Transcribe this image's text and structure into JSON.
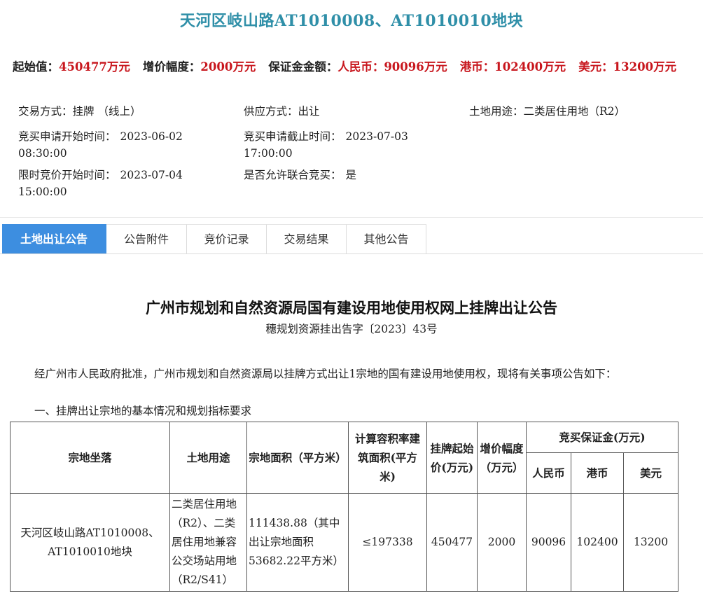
{
  "plot_title": "天河区岐山路AT1010008、AT1010010地块",
  "price_row": {
    "start_label": "起始值：",
    "start_value": "450477万元",
    "increment_label": "增价幅度：",
    "increment_value": "2000万元",
    "deposit_label": "保证金金额：",
    "rmb_label": "人民币：",
    "rmb_value": "90096万元",
    "hkd_label": "港币：",
    "hkd_value": "102400万元",
    "usd_label": "美元：",
    "usd_value": "13200万元"
  },
  "info": {
    "trade_mode_label": "交易方式：",
    "trade_mode_value": "挂牌 （线上）",
    "supply_mode_label": "供应方式：",
    "supply_mode_value": "出让",
    "land_use_label": "土地用途：",
    "land_use_value": "二类居住用地（R2）",
    "apply_start_label": "竞买申请开始时间：",
    "apply_start_date": "2023-06-02",
    "apply_start_time": "08:30:00",
    "apply_end_label": "竞买申请截止时间：",
    "apply_end_date": "2023-07-03",
    "apply_end_time": "17:00:00",
    "bid_start_label": "限时竞价开始时间：",
    "bid_start_date": "2023-07-04",
    "bid_start_time": "15:00:00",
    "joint_bid_label": "是否允许联合竞买：",
    "joint_bid_value": "是"
  },
  "tabs": [
    "土地出让公告",
    "公告附件",
    "竞价记录",
    "交易结果",
    "其他公告"
  ],
  "doc": {
    "title": "广州市规划和自然资源局国有建设用地使用权网上挂牌出让公告",
    "subtitle": "穗规划资源挂出告字〔2023〕43号",
    "para1": "经广州市人民政府批准，广州市规划和自然资源局以挂牌方式出让1宗地的国有建设用地使用权，现将有关事项公告如下：",
    "section1": "一、挂牌出让宗地的基本情况和规划指标要求"
  },
  "table": {
    "headers": {
      "location": "宗地坐落",
      "use": "土地用途",
      "area": "宗地面积（平方米）",
      "far": "计算容积率建筑面积(平方米)",
      "start_price": "挂牌起始价(万元)",
      "increment": "增价幅度（万元）",
      "deposit": "竞买保证金(万元)",
      "rmb": "人民币",
      "hkd": "港币",
      "usd": "美元"
    },
    "row": {
      "location": "天河区岐山路AT1010008、AT1010010地块",
      "use": "二类居住用地（R2）、二类居住用地兼容公交场站用地（R2/S41）",
      "area": "111438.88（其中出让宗地面积53682.22平方米）",
      "far": "≤197338",
      "start_price": "450477",
      "increment": "2000",
      "rmb": "90096",
      "hkd": "102400",
      "usd": "13200"
    }
  },
  "colors": {
    "title": "#2f8fa8",
    "price_value": "#c8161d",
    "tab_active": "#3d8ee0"
  }
}
